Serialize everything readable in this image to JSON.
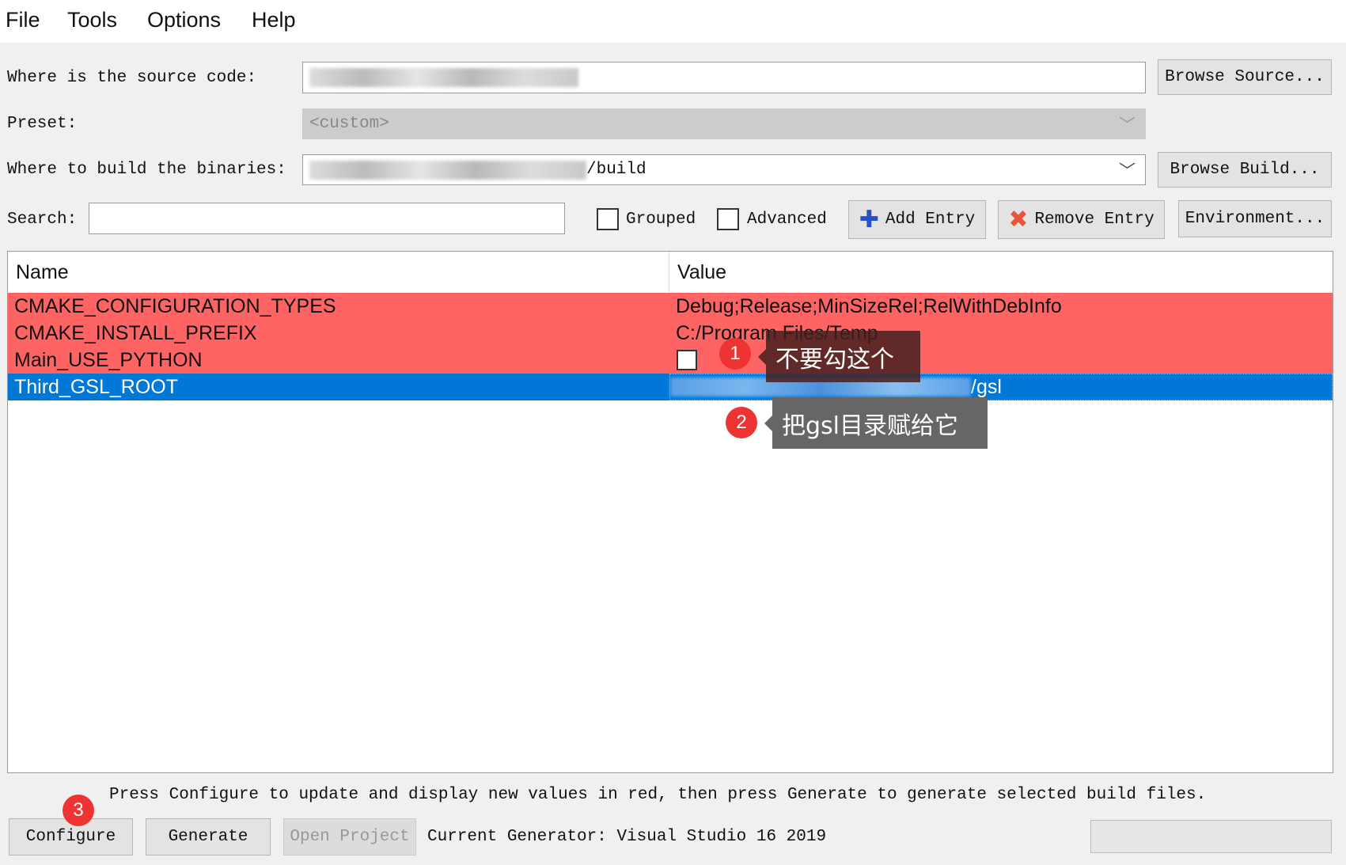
{
  "menu": [
    "File",
    "Tools",
    "Options",
    "Help"
  ],
  "source": {
    "label": "Where is the source code:",
    "value_suffix": "",
    "browse": "Browse Source..."
  },
  "preset": {
    "label": "Preset:",
    "value": "<custom>"
  },
  "build": {
    "label": "Where to build the binaries:",
    "value_suffix": "/build",
    "browse": "Browse Build..."
  },
  "search": {
    "label": "Search:",
    "value": ""
  },
  "options": {
    "grouped": "Grouped",
    "advanced": "Advanced",
    "grouped_checked": false,
    "advanced_checked": false
  },
  "toolbar": {
    "add": "Add Entry",
    "remove": "Remove Entry",
    "environment": "Environment..."
  },
  "table": {
    "headers": [
      "Name",
      "Value"
    ],
    "rows": [
      {
        "name": "CMAKE_CONFIGURATION_TYPES",
        "value": "Debug;Release;MinSizeRel;RelWithDebInfo",
        "state": "new"
      },
      {
        "name": "CMAKE_INSTALL_PREFIX",
        "value": "C:/Program Files/Temp",
        "state": "new"
      },
      {
        "name": "Main_USE_PYTHON",
        "value": "",
        "checkbox": false,
        "state": "new"
      },
      {
        "name": "Third_GSL_ROOT",
        "value": "/gsl",
        "state": "selected"
      }
    ]
  },
  "annotations": [
    {
      "number": "1",
      "text": "不要勾这个"
    },
    {
      "number": "2",
      "text": "把gsl目录赋给它"
    },
    {
      "number": "3"
    }
  ],
  "status": "Press Configure to update and display new values in red, then press Generate to generate selected build files.",
  "bottom": {
    "configure": "Configure",
    "generate": "Generate",
    "open_project": "Open Project",
    "generator": "Current Generator: Visual Studio 16 2019",
    "progress": 0
  },
  "colors": {
    "new_row": "#ff6464",
    "selected_row": "#0078d7",
    "annotation_badge": "#ee3333"
  }
}
